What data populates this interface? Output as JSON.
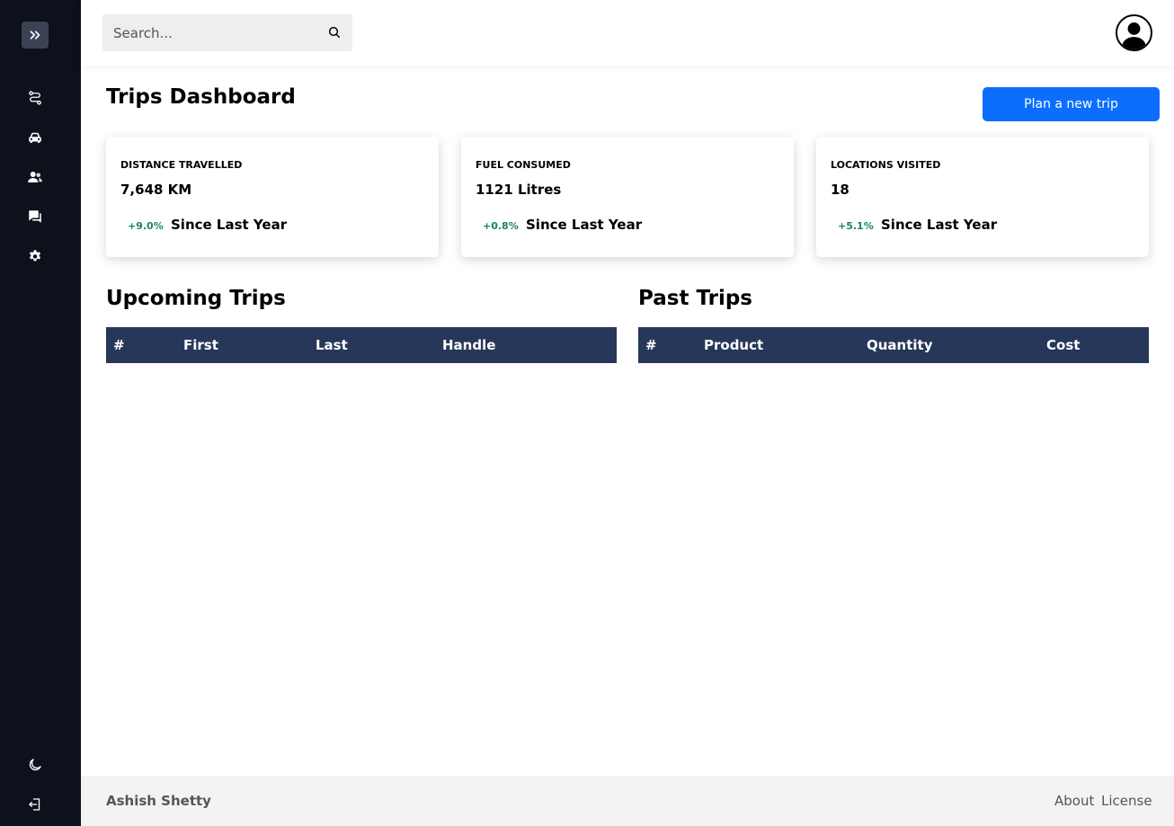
{
  "search": {
    "placeholder": "Search..."
  },
  "page": {
    "title": "Trips Dashboard",
    "plan_button": "Plan a new trip"
  },
  "cards": [
    {
      "label": "DISTANCE TRAVELLED",
      "value": "7,648 KM",
      "change": "+9.0%",
      "since": "Since Last Year"
    },
    {
      "label": "FUEL CONSUMED",
      "value": "1121 Litres",
      "change": "+0.8%",
      "since": "Since Last Year"
    },
    {
      "label": "LOCATIONS VISITED",
      "value": "18",
      "change": "+5.1%",
      "since": "Since Last Year"
    }
  ],
  "upcoming": {
    "title": "Upcoming Trips",
    "columns": [
      "#",
      "First",
      "Last",
      "Handle"
    ]
  },
  "past": {
    "title": "Past Trips",
    "columns": [
      "#",
      "Product",
      "Quantity",
      "Cost"
    ]
  },
  "footer": {
    "name": "Ashish Shetty",
    "links": [
      "About",
      "License"
    ]
  },
  "colors": {
    "sidebar": "#0c111c",
    "accent": "#0d6efd",
    "table_header": "#27375a",
    "positive": "#198754"
  },
  "sidebar_icons": [
    "chevrons-right-icon",
    "route-icon",
    "car-icon",
    "users-icon",
    "chat-icon",
    "gear-icon",
    "moon-icon",
    "logout-icon"
  ]
}
